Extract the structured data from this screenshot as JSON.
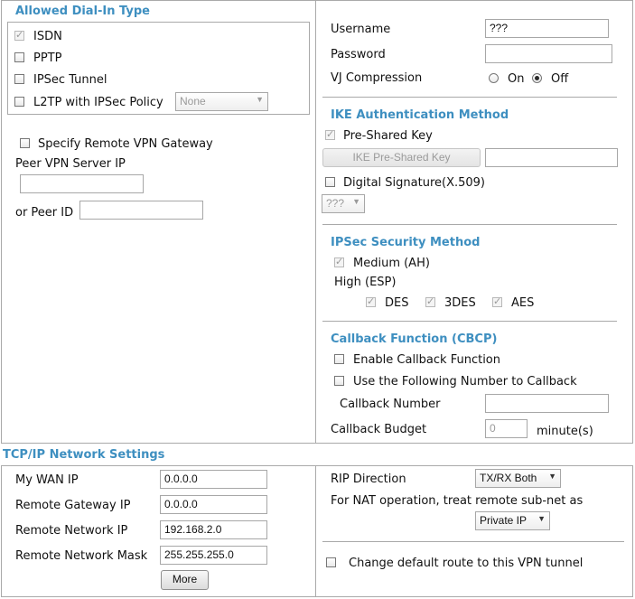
{
  "dialin": {
    "title": "Allowed Dial-In Type",
    "isdn": "ISDN",
    "pptp": "PPTP",
    "ipsec_tunnel": "IPSec Tunnel",
    "l2tp": "L2TP with IPSec Policy",
    "l2tp_policy": "None"
  },
  "remote_gw": {
    "specify": "Specify Remote VPN Gateway",
    "peer_server_label": "Peer VPN Server IP",
    "peer_server_value": "",
    "peer_id_label": "or Peer ID",
    "peer_id_value": ""
  },
  "account": {
    "username_label": "Username",
    "username_value": "???",
    "password_label": "Password",
    "password_value": "",
    "vj_label": "VJ Compression",
    "vj_on": "On",
    "vj_off": "Off"
  },
  "ike": {
    "title": "IKE Authentication Method",
    "psk": "Pre-Shared Key",
    "psk_button": "IKE Pre-Shared Key",
    "psk_value": "",
    "digital_sig": "Digital Signature(X.509)",
    "cert_select": "???"
  },
  "ipsec": {
    "title": "IPSec Security Method",
    "medium": "Medium (AH)",
    "high": "High (ESP)",
    "des": "DES",
    "tdes": "3DES",
    "aes": "AES"
  },
  "callback": {
    "title": "Callback Function (CBCP)",
    "enable": "Enable Callback Function",
    "use_number": "Use the Following Number to Callback",
    "number_label": "Callback Number",
    "number_value": "",
    "budget_label": "Callback Budget",
    "budget_value": "0",
    "budget_unit": "minute(s)"
  },
  "tcpip": {
    "title": "TCP/IP Network Settings",
    "wan_label": "My WAN IP",
    "wan_value": "0.0.0.0",
    "gw_label": "Remote Gateway IP",
    "gw_value": "0.0.0.0",
    "net_label": "Remote Network IP",
    "net_value": "192.168.2.0",
    "mask_label": "Remote Network Mask",
    "mask_value": "255.255.255.0",
    "more": "More",
    "rip_label": "RIP Direction",
    "rip_value": "TX/RX Both",
    "nat_label": "For NAT operation, treat remote sub-net as",
    "nat_value": "Private IP",
    "default_route": "Change default route to this VPN tunnel"
  }
}
